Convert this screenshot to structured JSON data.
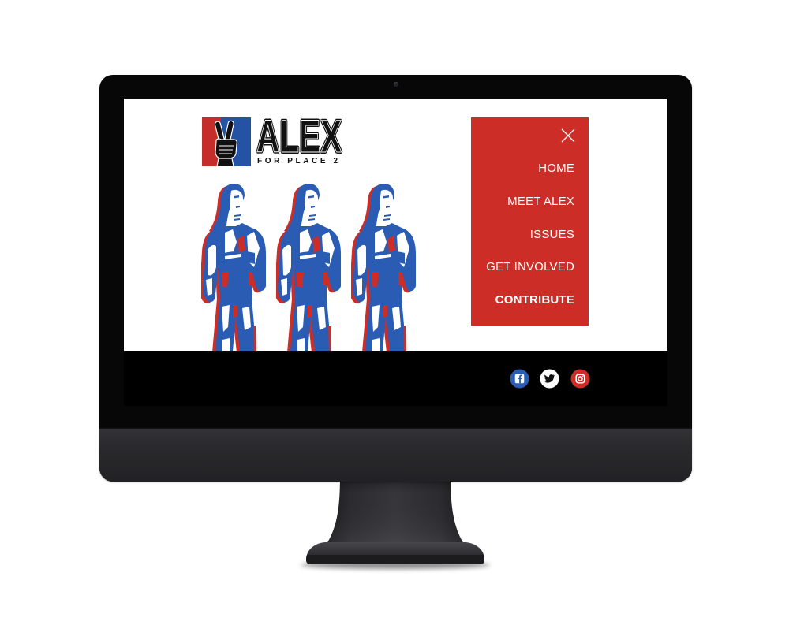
{
  "site": {
    "logo": {
      "icon": "peace-hand-icon",
      "title": "ALEX",
      "subtitle": "FOR PLACE 2",
      "colors": {
        "left": "#c42d2a",
        "right": "#2453a6"
      }
    },
    "hero": {
      "colors": {
        "primary": "#2b5cb3",
        "accent": "#cc2e27"
      }
    },
    "menu": {
      "background": "#cc2e27",
      "close_icon": "close-icon",
      "items": [
        {
          "label": "HOME"
        },
        {
          "label": "MEET ALEX"
        },
        {
          "label": "ISSUES"
        },
        {
          "label": "GET INVOLVED"
        },
        {
          "label": "CONTRIBUTE"
        }
      ]
    },
    "social": [
      {
        "icon": "facebook-icon",
        "color": "#2b5cb3"
      },
      {
        "icon": "twitter-icon",
        "color": "#ffffff"
      },
      {
        "icon": "instagram-icon",
        "color": "#cc2e27"
      }
    ]
  }
}
